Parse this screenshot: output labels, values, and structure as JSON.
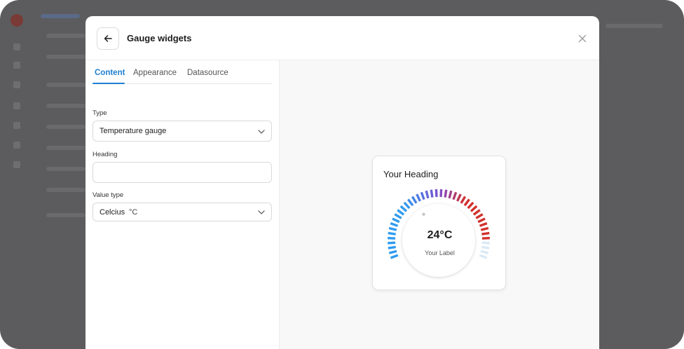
{
  "modal": {
    "title": "Gauge widgets"
  },
  "tabs": [
    {
      "label": "Content",
      "active": true
    },
    {
      "label": "Appearance",
      "active": false
    },
    {
      "label": "Datasource",
      "active": false
    }
  ],
  "form": {
    "type": {
      "label": "Type",
      "value": "Temperature gauge"
    },
    "heading": {
      "label": "Heading",
      "value": ""
    },
    "value_type": {
      "label": "Value type",
      "value": "Celcius",
      "unit": "°C"
    }
  },
  "preview": {
    "heading": "Your Heading",
    "value_display": "24°C",
    "label": "Your Label",
    "gauge_level": 0.9,
    "colors": {
      "cold": "#2f9bf0",
      "mid": "#7d4fd0",
      "hot": "#d2302c",
      "empty": "#d9e9f6"
    }
  },
  "icons": {
    "back": "arrow-left-icon",
    "close": "close-icon",
    "chevron": "chevron-down-icon"
  },
  "colors": {
    "accent": "#1f7fd1",
    "overlay": "#5c5c5e"
  }
}
